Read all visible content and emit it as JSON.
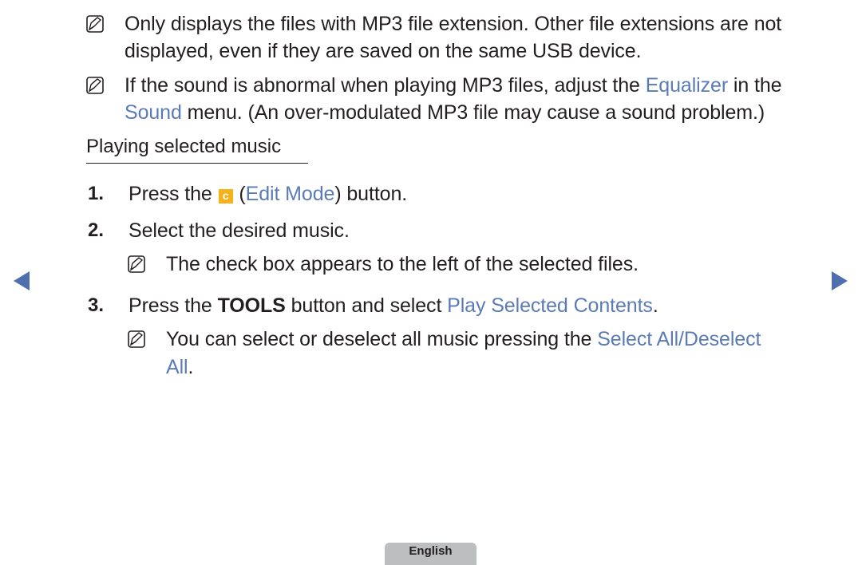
{
  "notes": [
    {
      "icon": "note-icon",
      "lines": [
        "Only displays the files with MP3 file extension. Other file extensions are not",
        "displayed, even if they are saved on the same USB device."
      ]
    },
    {
      "icon": "note-icon",
      "line1_pre": "If the sound is abnormal when playing MP3 files, adjust the ",
      "line1_hl": "Equalizer",
      "line1_post": " in the",
      "line2_hl": "Sound",
      "line2_post": " menu. (An over-modulated MP3 file may cause a sound problem.)"
    }
  ],
  "section": {
    "heading": "Playing selected music"
  },
  "steps": [
    {
      "number": "1.",
      "pre": "Press the ",
      "button_key": "c",
      "mid": " (",
      "hl": "Edit Mode",
      "post": ") button."
    },
    {
      "number": "2.",
      "text": "Select the desired music.",
      "note": "The check box appears to the left of the selected files."
    },
    {
      "number": "3.",
      "pre": "Press the ",
      "bold": "TOOLS",
      "mid": " button and select ",
      "hl": "Play Selected Contents",
      "post": ".",
      "note_pre": "You can select or deselect all music pressing the ",
      "note_hl1": "Select All/Deselect",
      "note_hl2": "All",
      "note_post": "."
    }
  ],
  "navigation": {
    "prev_icon": "triangle-left",
    "next_icon": "triangle-right"
  },
  "footer": {
    "language": "English"
  },
  "colors": {
    "highlight": "#5b7bb5",
    "nav_arrow": "#4f6fae",
    "key_c": "#f6b21b",
    "lang_tab": "#bcbec0"
  }
}
